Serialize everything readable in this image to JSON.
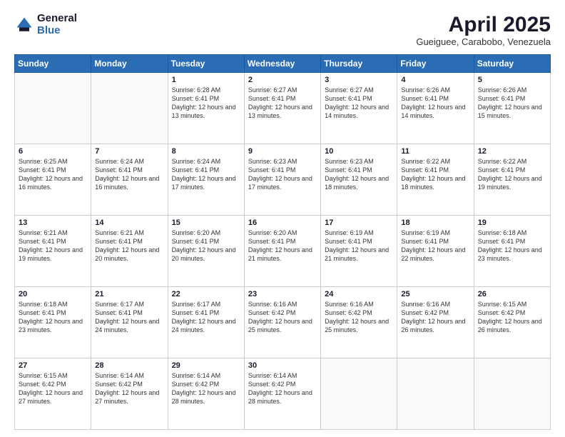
{
  "logo": {
    "general": "General",
    "blue": "Blue"
  },
  "header": {
    "title": "April 2025",
    "subtitle": "Gueiguee, Carabobo, Venezuela"
  },
  "weekdays": [
    "Sunday",
    "Monday",
    "Tuesday",
    "Wednesday",
    "Thursday",
    "Friday",
    "Saturday"
  ],
  "weeks": [
    [
      {
        "day": "",
        "info": ""
      },
      {
        "day": "",
        "info": ""
      },
      {
        "day": "1",
        "info": "Sunrise: 6:28 AM\nSunset: 6:41 PM\nDaylight: 12 hours and 13 minutes."
      },
      {
        "day": "2",
        "info": "Sunrise: 6:27 AM\nSunset: 6:41 PM\nDaylight: 12 hours and 13 minutes."
      },
      {
        "day": "3",
        "info": "Sunrise: 6:27 AM\nSunset: 6:41 PM\nDaylight: 12 hours and 14 minutes."
      },
      {
        "day": "4",
        "info": "Sunrise: 6:26 AM\nSunset: 6:41 PM\nDaylight: 12 hours and 14 minutes."
      },
      {
        "day": "5",
        "info": "Sunrise: 6:26 AM\nSunset: 6:41 PM\nDaylight: 12 hours and 15 minutes."
      }
    ],
    [
      {
        "day": "6",
        "info": "Sunrise: 6:25 AM\nSunset: 6:41 PM\nDaylight: 12 hours and 16 minutes."
      },
      {
        "day": "7",
        "info": "Sunrise: 6:24 AM\nSunset: 6:41 PM\nDaylight: 12 hours and 16 minutes."
      },
      {
        "day": "8",
        "info": "Sunrise: 6:24 AM\nSunset: 6:41 PM\nDaylight: 12 hours and 17 minutes."
      },
      {
        "day": "9",
        "info": "Sunrise: 6:23 AM\nSunset: 6:41 PM\nDaylight: 12 hours and 17 minutes."
      },
      {
        "day": "10",
        "info": "Sunrise: 6:23 AM\nSunset: 6:41 PM\nDaylight: 12 hours and 18 minutes."
      },
      {
        "day": "11",
        "info": "Sunrise: 6:22 AM\nSunset: 6:41 PM\nDaylight: 12 hours and 18 minutes."
      },
      {
        "day": "12",
        "info": "Sunrise: 6:22 AM\nSunset: 6:41 PM\nDaylight: 12 hours and 19 minutes."
      }
    ],
    [
      {
        "day": "13",
        "info": "Sunrise: 6:21 AM\nSunset: 6:41 PM\nDaylight: 12 hours and 19 minutes."
      },
      {
        "day": "14",
        "info": "Sunrise: 6:21 AM\nSunset: 6:41 PM\nDaylight: 12 hours and 20 minutes."
      },
      {
        "day": "15",
        "info": "Sunrise: 6:20 AM\nSunset: 6:41 PM\nDaylight: 12 hours and 20 minutes."
      },
      {
        "day": "16",
        "info": "Sunrise: 6:20 AM\nSunset: 6:41 PM\nDaylight: 12 hours and 21 minutes."
      },
      {
        "day": "17",
        "info": "Sunrise: 6:19 AM\nSunset: 6:41 PM\nDaylight: 12 hours and 21 minutes."
      },
      {
        "day": "18",
        "info": "Sunrise: 6:19 AM\nSunset: 6:41 PM\nDaylight: 12 hours and 22 minutes."
      },
      {
        "day": "19",
        "info": "Sunrise: 6:18 AM\nSunset: 6:41 PM\nDaylight: 12 hours and 23 minutes."
      }
    ],
    [
      {
        "day": "20",
        "info": "Sunrise: 6:18 AM\nSunset: 6:41 PM\nDaylight: 12 hours and 23 minutes."
      },
      {
        "day": "21",
        "info": "Sunrise: 6:17 AM\nSunset: 6:41 PM\nDaylight: 12 hours and 24 minutes."
      },
      {
        "day": "22",
        "info": "Sunrise: 6:17 AM\nSunset: 6:41 PM\nDaylight: 12 hours and 24 minutes."
      },
      {
        "day": "23",
        "info": "Sunrise: 6:16 AM\nSunset: 6:42 PM\nDaylight: 12 hours and 25 minutes."
      },
      {
        "day": "24",
        "info": "Sunrise: 6:16 AM\nSunset: 6:42 PM\nDaylight: 12 hours and 25 minutes."
      },
      {
        "day": "25",
        "info": "Sunrise: 6:16 AM\nSunset: 6:42 PM\nDaylight: 12 hours and 26 minutes."
      },
      {
        "day": "26",
        "info": "Sunrise: 6:15 AM\nSunset: 6:42 PM\nDaylight: 12 hours and 26 minutes."
      }
    ],
    [
      {
        "day": "27",
        "info": "Sunrise: 6:15 AM\nSunset: 6:42 PM\nDaylight: 12 hours and 27 minutes."
      },
      {
        "day": "28",
        "info": "Sunrise: 6:14 AM\nSunset: 6:42 PM\nDaylight: 12 hours and 27 minutes."
      },
      {
        "day": "29",
        "info": "Sunrise: 6:14 AM\nSunset: 6:42 PM\nDaylight: 12 hours and 28 minutes."
      },
      {
        "day": "30",
        "info": "Sunrise: 6:14 AM\nSunset: 6:42 PM\nDaylight: 12 hours and 28 minutes."
      },
      {
        "day": "",
        "info": ""
      },
      {
        "day": "",
        "info": ""
      },
      {
        "day": "",
        "info": ""
      }
    ]
  ]
}
